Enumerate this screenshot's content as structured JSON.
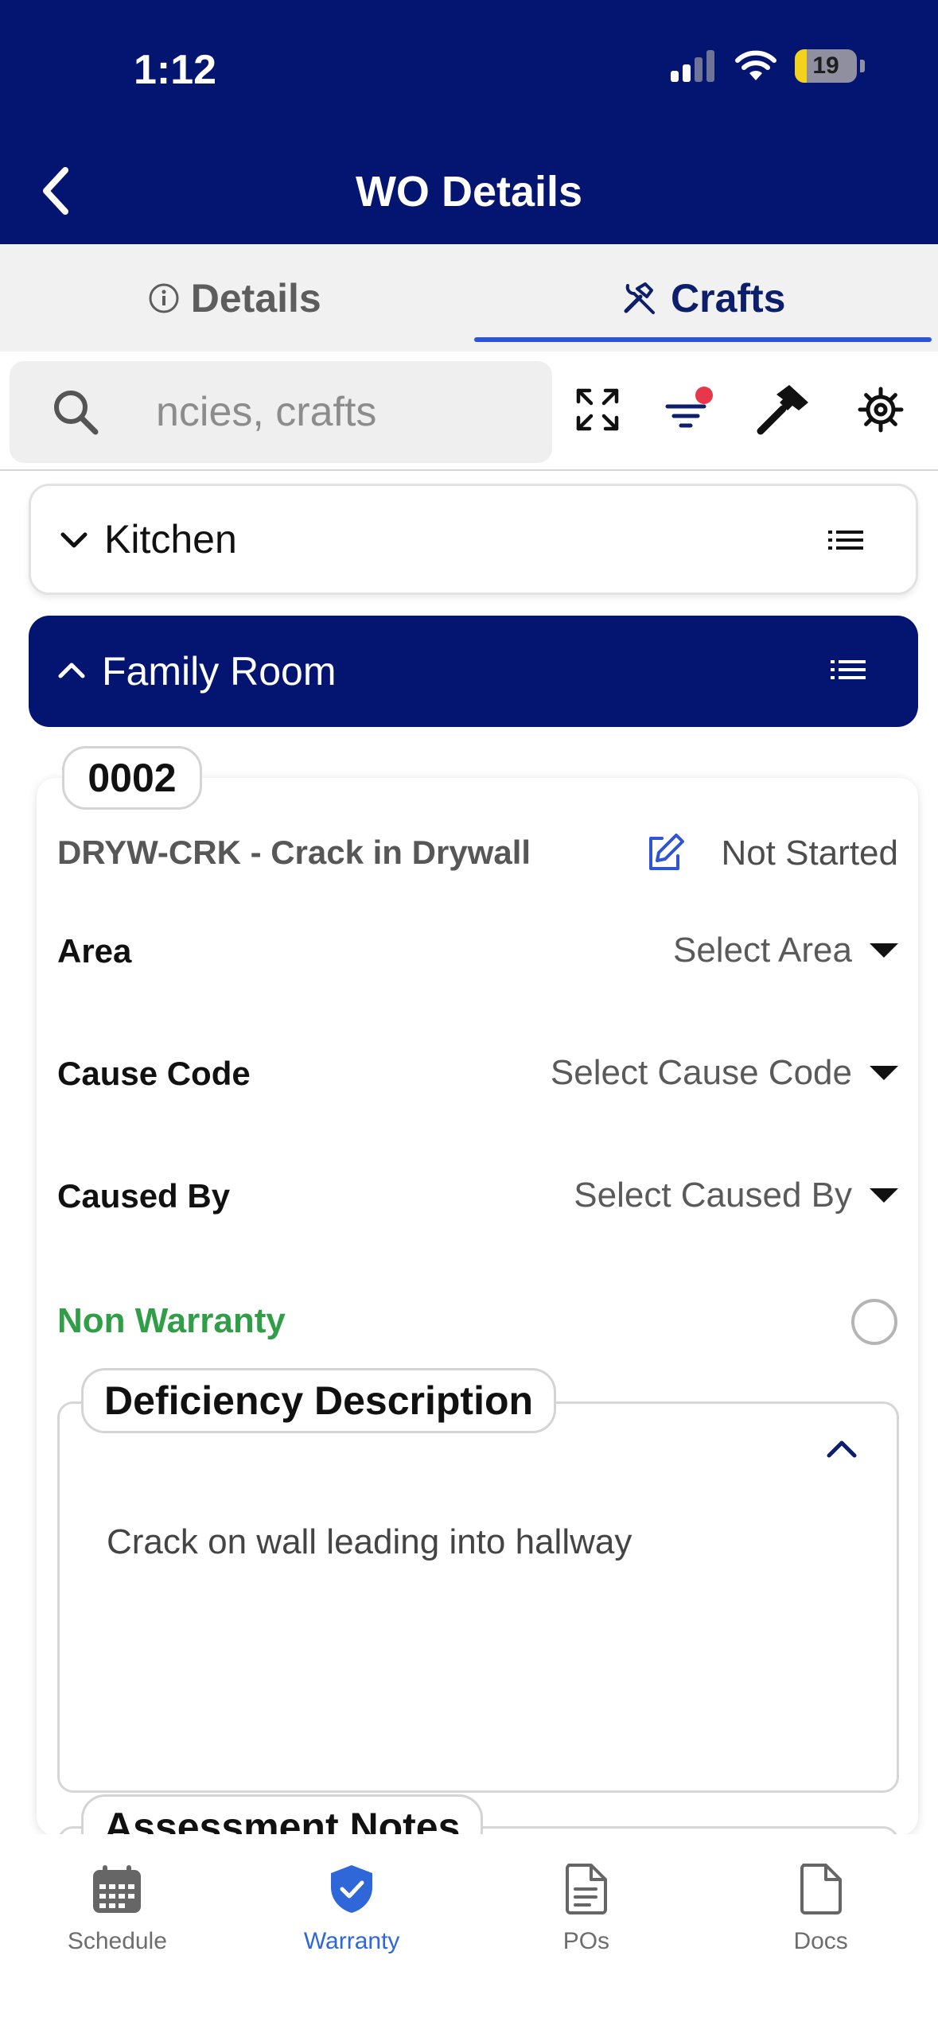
{
  "status_bar": {
    "time": "1:12",
    "battery": "19",
    "battery_level": 0.19
  },
  "header": {
    "title": "WO Details"
  },
  "tabs": [
    {
      "label": "Details",
      "active": false
    },
    {
      "label": "Crafts",
      "active": true
    }
  ],
  "search": {
    "value": "ncies, crafts"
  },
  "groups": [
    {
      "name": "Kitchen",
      "expanded": false
    },
    {
      "name": "Family Room",
      "expanded": true
    }
  ],
  "item": {
    "code": "0002",
    "title": "DRYW-CRK - Crack in Drywall",
    "status": "Not Started",
    "fields": [
      {
        "label": "Area",
        "value": "Select Area"
      },
      {
        "label": "Cause Code",
        "value": "Select Cause Code"
      },
      {
        "label": "Caused By",
        "value": "Select Caused By"
      }
    ],
    "non_warranty_label": "Non Warranty",
    "description_label": "Deficiency Description",
    "description_text": "Crack on wall leading into hallway",
    "notes_label": "Assessment Notes"
  },
  "bottom_nav": [
    {
      "label": "Schedule",
      "icon": "calendar-icon",
      "active": false
    },
    {
      "label": "Warranty",
      "icon": "shield-check-icon",
      "active": true
    },
    {
      "label": "POs",
      "icon": "document-lines-icon",
      "active": false
    },
    {
      "label": "Docs",
      "icon": "document-icon",
      "active": false
    }
  ],
  "colors": {
    "primary": "#031570",
    "accent": "#2f66d8",
    "non_warranty": "#2f9e47",
    "notification_dot": "#e8374b"
  }
}
